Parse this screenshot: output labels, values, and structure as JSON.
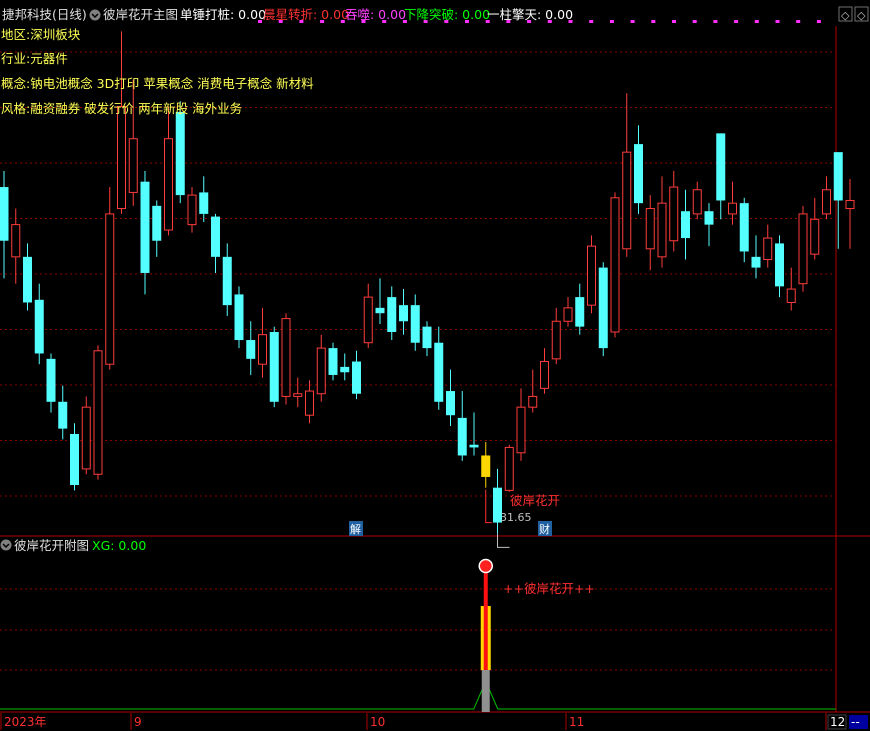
{
  "header": {
    "stock": "捷邦科技(日线)",
    "indicator": "彼岸花开主图",
    "items": [
      {
        "label": "单锤打桩: 0.00",
        "color": "#ffffff"
      },
      {
        "label": "晨星转折: 0.00",
        "color": "#ff3030"
      },
      {
        "label": "吞噬: 0.00",
        "color": "#ff40ff"
      },
      {
        "label": "下降突破: 0.00",
        "color": "#00ff00"
      },
      {
        "label": "一柱擎天: 0.00",
        "color": "#ffffff"
      }
    ],
    "window_buttons": [
      "◇",
      "◇"
    ]
  },
  "info_lines": [
    "地区:深圳板块",
    "行业:元器件",
    "概念:钠电池概念 3D打印 苹果概念 消费电子概念 新材料",
    "风格:融资融券 破发行价 两年新股 海外业务"
  ],
  "markers": {
    "signal_label": "彼岸花开",
    "low_price_label": "31.65",
    "event_tag_1": "解",
    "event_tag_2": "财"
  },
  "sub_panel": {
    "title": "彼岸花开附图",
    "xg_label": "XG: 0.00",
    "signal_label": "++彼岸花开++"
  },
  "x_axis": {
    "labels": [
      "2023年",
      "9",
      "10",
      "11",
      "12"
    ],
    "corner": "--"
  },
  "colors": {
    "up": "#ff3c3c",
    "down": "#54ffff",
    "grid": "#8b0000",
    "signal_bar": "#ffd700",
    "text_yellow": "#ffff54"
  },
  "chart_data": {
    "type": "candlestick",
    "lowest_marked_price": 31.65,
    "candles": [
      {
        "dir": "down",
        "open": 43.0,
        "close": 41.0,
        "high": 43.6,
        "low": 39.6
      },
      {
        "dir": "up",
        "open": 40.4,
        "close": 41.6,
        "high": 42.2,
        "low": 39.4
      },
      {
        "dir": "down",
        "open": 40.4,
        "close": 38.7,
        "high": 40.9,
        "low": 38.4
      },
      {
        "dir": "down",
        "open": 38.8,
        "close": 36.8,
        "high": 39.4,
        "low": 36.4
      },
      {
        "dir": "down",
        "open": 36.6,
        "close": 35.0,
        "high": 36.8,
        "low": 34.6
      },
      {
        "dir": "down",
        "open": 35.0,
        "close": 34.0,
        "high": 35.6,
        "low": 33.6
      },
      {
        "dir": "down",
        "open": 33.8,
        "close": 31.9,
        "high": 34.2,
        "low": 31.7
      },
      {
        "dir": "up",
        "open": 32.5,
        "close": 34.8,
        "high": 35.2,
        "low": 32.3
      },
      {
        "dir": "up",
        "open": 32.3,
        "close": 36.9,
        "high": 37.1,
        "low": 32.1
      },
      {
        "dir": "up",
        "open": 36.4,
        "close": 42.0,
        "high": 43.0,
        "low": 36.2
      },
      {
        "dir": "up",
        "open": 42.2,
        "close": 46.0,
        "high": 48.8,
        "low": 42.0
      },
      {
        "dir": "up",
        "open": 42.8,
        "close": 44.8,
        "high": 47.0,
        "low": 42.3
      },
      {
        "dir": "down",
        "open": 43.2,
        "close": 39.8,
        "high": 43.6,
        "low": 39.0
      },
      {
        "dir": "down",
        "open": 42.3,
        "close": 41.0,
        "high": 42.5,
        "low": 40.4
      },
      {
        "dir": "up",
        "open": 41.4,
        "close": 44.8,
        "high": 46.0,
        "low": 41.2
      },
      {
        "dir": "down",
        "open": 45.8,
        "close": 42.7,
        "high": 46.2,
        "low": 42.4
      },
      {
        "dir": "up",
        "open": 41.6,
        "close": 42.7,
        "high": 43.0,
        "low": 41.3
      },
      {
        "dir": "down",
        "open": 42.8,
        "close": 42.0,
        "high": 43.4,
        "low": 41.7
      },
      {
        "dir": "down",
        "open": 41.9,
        "close": 40.4,
        "high": 42.0,
        "low": 39.8
      },
      {
        "dir": "down",
        "open": 40.4,
        "close": 38.6,
        "high": 40.9,
        "low": 38.2
      },
      {
        "dir": "down",
        "open": 39.0,
        "close": 37.3,
        "high": 39.3,
        "low": 37.0
      },
      {
        "dir": "down",
        "open": 37.3,
        "close": 36.6,
        "high": 38.0,
        "low": 36.0
      },
      {
        "dir": "up",
        "open": 36.4,
        "close": 37.5,
        "high": 38.5,
        "low": 35.9
      },
      {
        "dir": "down",
        "open": 37.6,
        "close": 35.0,
        "high": 37.8,
        "low": 34.8
      },
      {
        "dir": "up",
        "open": 35.2,
        "close": 38.1,
        "high": 38.3,
        "low": 34.9
      },
      {
        "dir": "up",
        "open": 35.2,
        "close": 35.3,
        "high": 35.9,
        "low": 34.8
      },
      {
        "dir": "up",
        "open": 34.5,
        "close": 35.4,
        "high": 35.8,
        "low": 34.2
      },
      {
        "dir": "up",
        "open": 35.3,
        "close": 37.0,
        "high": 37.5,
        "low": 35.0
      },
      {
        "dir": "down",
        "open": 37.0,
        "close": 36.0,
        "high": 37.2,
        "low": 35.8
      },
      {
        "dir": "down",
        "open": 36.3,
        "close": 36.1,
        "high": 36.8,
        "low": 35.8
      },
      {
        "dir": "down",
        "open": 36.5,
        "close": 35.3,
        "high": 36.9,
        "low": 35.1
      },
      {
        "dir": "up",
        "open": 37.2,
        "close": 38.9,
        "high": 39.4,
        "low": 37.0
      },
      {
        "dir": "down",
        "open": 38.5,
        "close": 38.3,
        "high": 39.6,
        "low": 37.9
      },
      {
        "dir": "down",
        "open": 38.9,
        "close": 37.6,
        "high": 39.3,
        "low": 37.3
      },
      {
        "dir": "down",
        "open": 38.6,
        "close": 38.0,
        "high": 39.2,
        "low": 37.5
      },
      {
        "dir": "down",
        "open": 38.6,
        "close": 37.2,
        "high": 39.0,
        "low": 36.9
      },
      {
        "dir": "down",
        "open": 37.8,
        "close": 37.0,
        "high": 38.0,
        "low": 36.7
      },
      {
        "dir": "down",
        "open": 37.2,
        "close": 35.0,
        "high": 37.8,
        "low": 34.7
      },
      {
        "dir": "down",
        "open": 35.4,
        "close": 34.5,
        "high": 36.2,
        "low": 34.1
      },
      {
        "dir": "down",
        "open": 34.4,
        "close": 33.0,
        "high": 35.4,
        "low": 32.8
      },
      {
        "dir": "down",
        "open": 33.4,
        "close": 33.3,
        "high": 34.6,
        "low": 33.0
      },
      {
        "dir": "down",
        "open": 33.0,
        "close": 32.2,
        "high": 33.5,
        "low": 31.8
      },
      {
        "dir": "down",
        "open": 31.8,
        "close": 30.5,
        "high": 32.5,
        "low": 30.1
      },
      {
        "dir": "up",
        "open": 31.7,
        "close": 33.3,
        "high": 33.4,
        "low": 31.65
      },
      {
        "dir": "up",
        "open": 33.1,
        "close": 34.8,
        "high": 35.5,
        "low": 32.8
      },
      {
        "dir": "up",
        "open": 34.8,
        "close": 35.2,
        "high": 36.2,
        "low": 34.6
      },
      {
        "dir": "up",
        "open": 35.5,
        "close": 36.5,
        "high": 37.0,
        "low": 35.3
      },
      {
        "dir": "up",
        "open": 36.6,
        "close": 38.0,
        "high": 38.5,
        "low": 36.4
      },
      {
        "dir": "up",
        "open": 38.0,
        "close": 38.5,
        "high": 38.9,
        "low": 37.8
      },
      {
        "dir": "down",
        "open": 38.9,
        "close": 37.8,
        "high": 39.4,
        "low": 37.5
      },
      {
        "dir": "up",
        "open": 38.6,
        "close": 40.8,
        "high": 41.2,
        "low": 38.3
      },
      {
        "dir": "down",
        "open": 40.0,
        "close": 37.0,
        "high": 40.2,
        "low": 36.7
      },
      {
        "dir": "up",
        "open": 37.6,
        "close": 42.6,
        "high": 42.8,
        "low": 37.4
      },
      {
        "dir": "up",
        "open": 40.7,
        "close": 44.3,
        "high": 46.5,
        "low": 40.4
      },
      {
        "dir": "down",
        "open": 44.6,
        "close": 42.4,
        "high": 45.3,
        "low": 42.0
      },
      {
        "dir": "up",
        "open": 40.7,
        "close": 42.2,
        "high": 42.7,
        "low": 39.9
      },
      {
        "dir": "up",
        "open": 40.4,
        "close": 42.4,
        "high": 43.4,
        "low": 40.0
      },
      {
        "dir": "up",
        "open": 41.0,
        "close": 43.0,
        "high": 43.6,
        "low": 40.6
      },
      {
        "dir": "down",
        "open": 42.1,
        "close": 41.1,
        "high": 42.9,
        "low": 40.3
      },
      {
        "dir": "up",
        "open": 42.0,
        "close": 42.9,
        "high": 43.2,
        "low": 41.8
      },
      {
        "dir": "down",
        "open": 42.1,
        "close": 41.6,
        "high": 42.4,
        "low": 40.8
      },
      {
        "dir": "down",
        "open": 45.0,
        "close": 42.5,
        "high": 45.0,
        "low": 41.8
      },
      {
        "dir": "up",
        "open": 42.0,
        "close": 42.4,
        "high": 43.2,
        "low": 41.6
      },
      {
        "dir": "down",
        "open": 42.4,
        "close": 40.6,
        "high": 42.6,
        "low": 40.2
      },
      {
        "dir": "down",
        "open": 40.4,
        "close": 40.0,
        "high": 41.2,
        "low": 39.6
      },
      {
        "dir": "up",
        "open": 40.3,
        "close": 41.1,
        "high": 41.6,
        "low": 40.0
      },
      {
        "dir": "down",
        "open": 40.9,
        "close": 39.3,
        "high": 41.2,
        "low": 38.9
      },
      {
        "dir": "up",
        "open": 38.7,
        "close": 39.2,
        "high": 40.0,
        "low": 38.4
      },
      {
        "dir": "up",
        "open": 39.4,
        "close": 42.0,
        "high": 42.3,
        "low": 39.1
      },
      {
        "dir": "up",
        "open": 40.5,
        "close": 41.8,
        "high": 42.6,
        "low": 40.3
      },
      {
        "dir": "up",
        "open": 42.0,
        "close": 42.9,
        "high": 43.4,
        "low": 41.8
      },
      {
        "dir": "down",
        "open": 44.3,
        "close": 42.5,
        "high": 44.3,
        "low": 40.7
      },
      {
        "dir": "up",
        "open": 42.2,
        "close": 42.5,
        "high": 43.3,
        "low": 40.7
      }
    ],
    "signal": {
      "index": 41,
      "label": "彼岸花开"
    }
  }
}
